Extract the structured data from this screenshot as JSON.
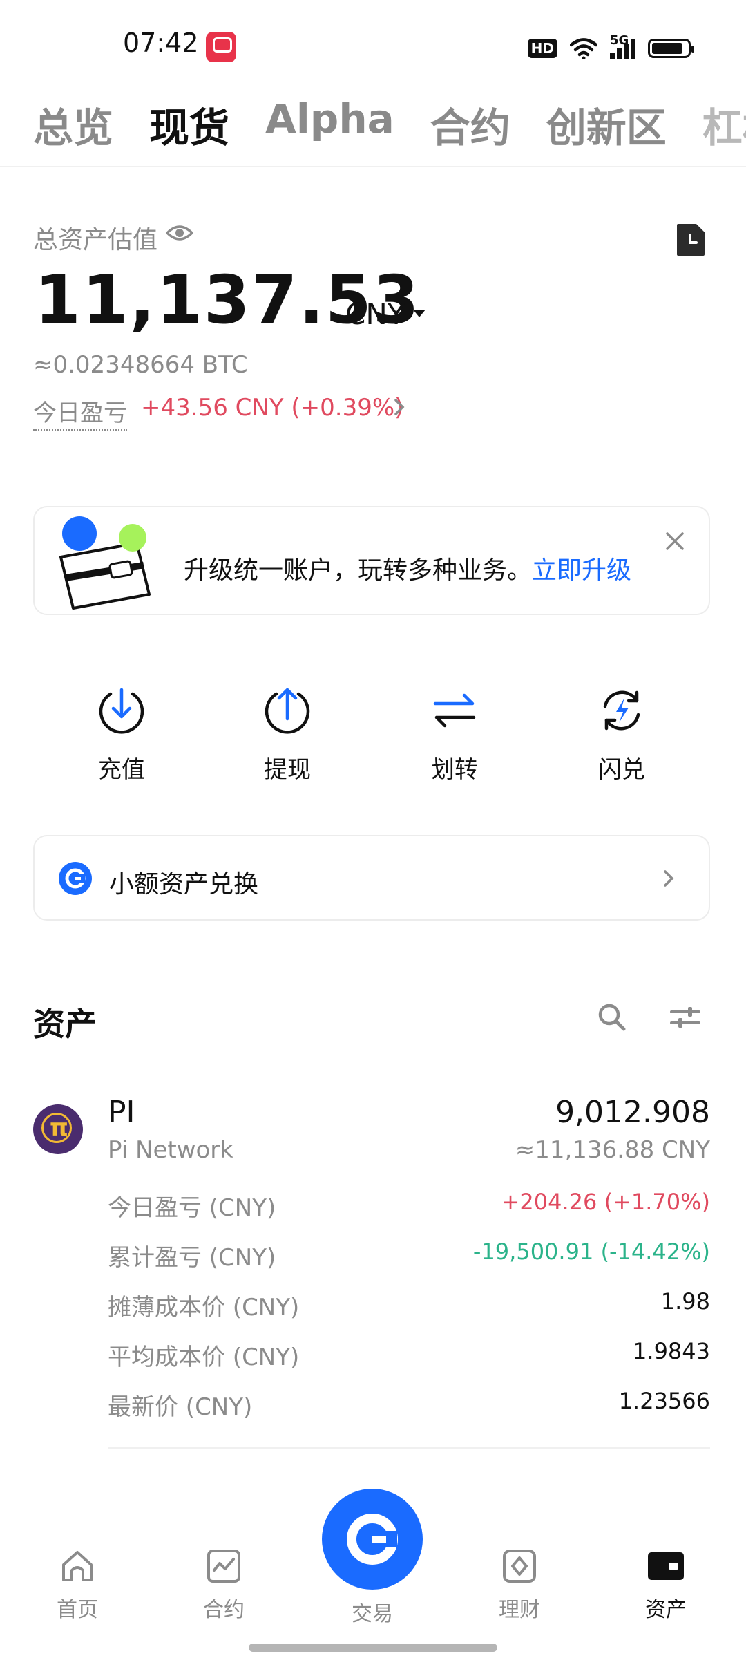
{
  "status_bar": {
    "time": "07:42",
    "hd_badge": "HD",
    "network": "5G"
  },
  "tabs": [
    "总览",
    "现货",
    "Alpha",
    "合约",
    "创新区",
    "杠杆"
  ],
  "balance": {
    "label": "总资产估值",
    "amount": "11,137.53",
    "unit": "CNY",
    "btc_value": "≈0.02348664 BTC",
    "pnl_label": "今日盈亏",
    "pnl_value": "+43.56 CNY (+0.39%)"
  },
  "banner": {
    "text": "升级统一账户，玩转多种业务。",
    "link": "立即升级"
  },
  "actions": [
    {
      "label": "充值",
      "icon": "deposit-icon"
    },
    {
      "label": "提现",
      "icon": "withdraw-icon"
    },
    {
      "label": "划转",
      "icon": "transfer-icon"
    },
    {
      "label": "闪兑",
      "icon": "flash-swap-icon"
    }
  ],
  "convert": {
    "label": "小额资产兑换"
  },
  "assets": {
    "title": "资产",
    "items": [
      {
        "symbol": "PI",
        "name": "Pi Network",
        "amount": "9,012.908",
        "cny_value": "≈11,136.88 CNY",
        "rows": [
          {
            "label": "今日盈亏 (CNY)",
            "value": "+204.26 (+1.70%)"
          },
          {
            "label": "累计盈亏 (CNY)",
            "value": "-19,500.91 (-14.42%)"
          },
          {
            "label": "摊薄成本价 (CNY)",
            "value": "1.98"
          },
          {
            "label": "平均成本价 (CNY)",
            "value": "1.9843"
          },
          {
            "label": "最新价 (CNY)",
            "value": "1.23566"
          }
        ]
      }
    ]
  },
  "bottom_nav": [
    {
      "label": "首页",
      "icon": "home-icon"
    },
    {
      "label": "合约",
      "icon": "futures-icon"
    },
    {
      "label": "交易",
      "icon": "trade-icon"
    },
    {
      "label": "理财",
      "icon": "earn-icon"
    },
    {
      "label": "资产",
      "icon": "wallet-icon"
    }
  ],
  "colors": {
    "accent": "#1a6bff",
    "profit": "#e04a5f",
    "loss": "#2bb38a"
  }
}
